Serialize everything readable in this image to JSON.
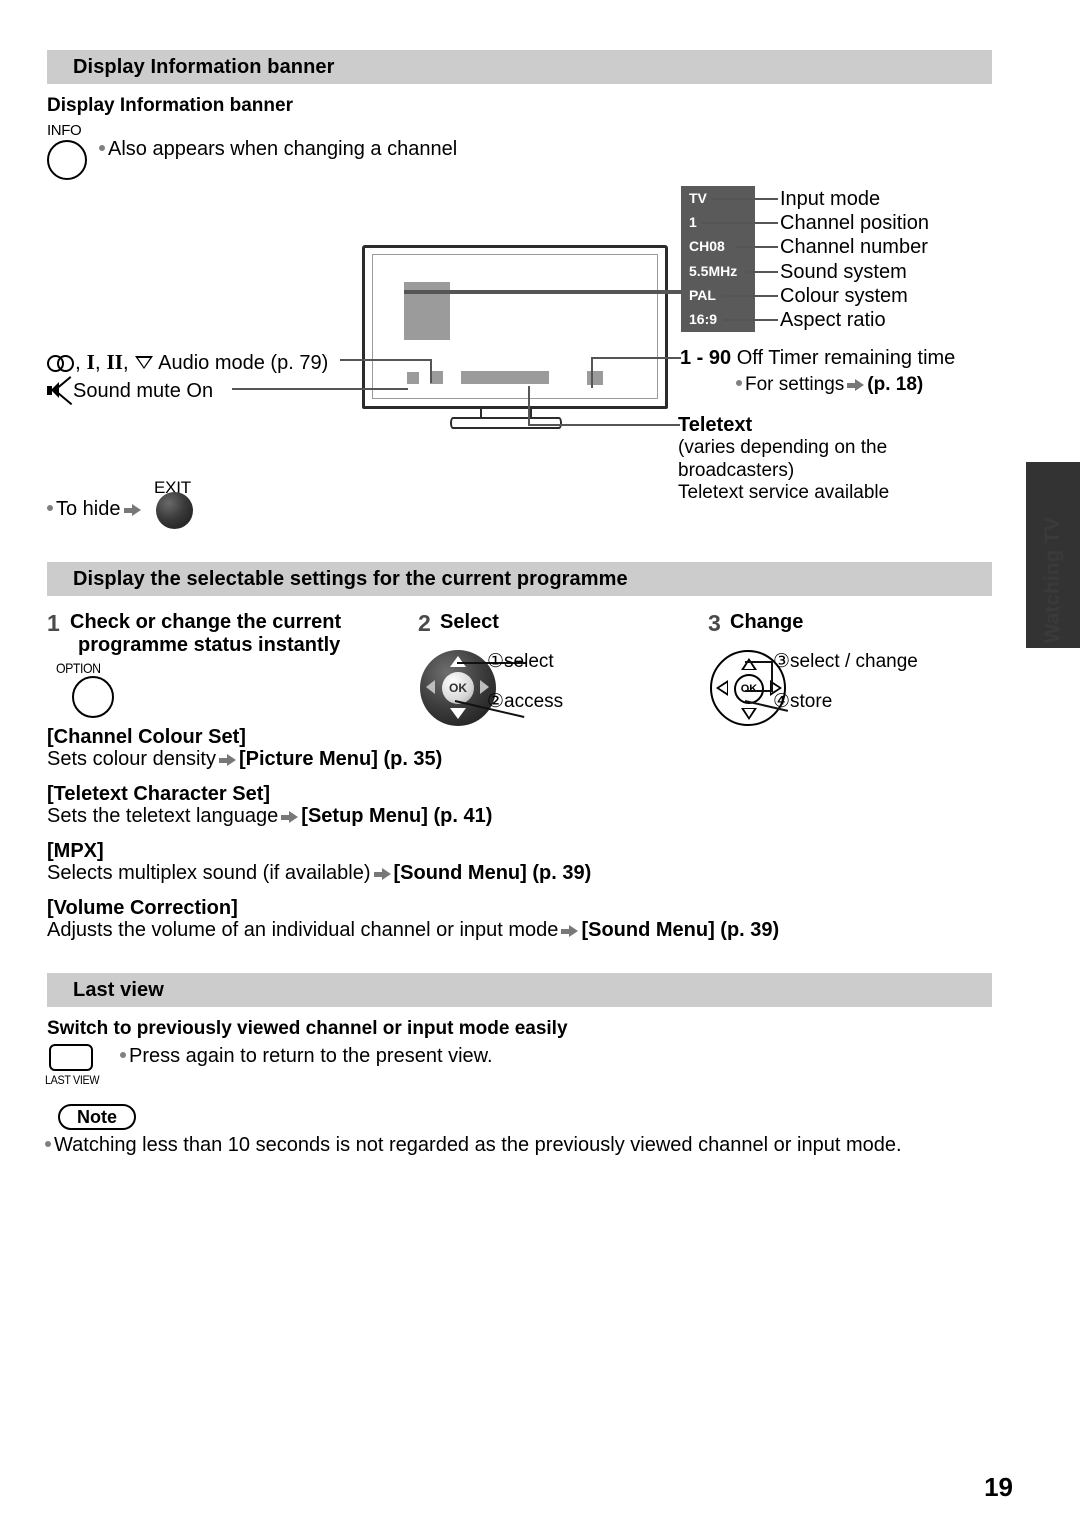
{
  "sections": {
    "display_info": {
      "bar_title": "Display Information banner",
      "subheading": "Display Information banner",
      "info_button_label": "INFO",
      "info_note": "Also appears when changing a channel",
      "audio_mode_label": "Audio mode (p. 79)",
      "sound_mute_label": "Sound mute On",
      "to_hide_label": "To hide",
      "exit_button_label": "EXIT"
    },
    "osd": {
      "rows": [
        {
          "value": "TV",
          "label": "Input mode"
        },
        {
          "value": "1",
          "label": "Channel position"
        },
        {
          "value": "CH08",
          "label": "Channel number"
        },
        {
          "value": "5.5MHz",
          "label": "Sound system"
        },
        {
          "value": "PAL",
          "label": "Colour system"
        },
        {
          "value": "16:9",
          "label": "Aspect ratio"
        }
      ],
      "off_timer_range": "1 - 90",
      "off_timer_label": "Off Timer remaining time",
      "off_timer_note": "For settings",
      "off_timer_ref": "(p. 18)",
      "teletext_heading": "Teletext",
      "teletext_line1": "(varies depending on the",
      "teletext_line2": "broadcasters)",
      "teletext_line3": "Teletext service available"
    },
    "selectable": {
      "bar_title": "Display the selectable settings for the current programme",
      "steps": [
        {
          "num": "1",
          "title_line1": "Check or change the current",
          "title_line2": "programme status instantly",
          "button_label": "OPTION"
        },
        {
          "num": "2",
          "title_line1": "Select",
          "title_line2": "",
          "callout1": "①select",
          "callout2": "②access",
          "ok_label": "OK"
        },
        {
          "num": "3",
          "title_line1": "Change",
          "title_line2": "",
          "callout1": "③select / change",
          "callout2": "④store",
          "ok_label": "OK"
        }
      ],
      "settings": [
        {
          "name": "[Channel Colour Set]",
          "desc_pre": "Sets colour density",
          "desc_post": "[Picture Menu] (p. 35)"
        },
        {
          "name": "[Teletext Character Set]",
          "desc_pre": "Sets the teletext language",
          "desc_post": "[Setup Menu] (p. 41)"
        },
        {
          "name": "[MPX]",
          "desc_pre": "Selects multiplex sound (if available)",
          "desc_post": "[Sound Menu] (p. 39)"
        },
        {
          "name": "[Volume Correction]",
          "desc_pre": "Adjusts the volume of an individual channel or input mode",
          "desc_post": "[Sound Menu] (p. 39)"
        }
      ]
    },
    "last_view": {
      "bar_title": "Last view",
      "subheading": "Switch to previously viewed channel or input mode easily",
      "button_label": "LAST VIEW",
      "note": "Press again to return to the present view."
    },
    "note_block": {
      "pill_label": "Note",
      "text": "Watching less than 10 seconds is not regarded as the previously viewed channel or input mode."
    }
  },
  "side_tab": {
    "label": "Watching TV"
  },
  "page_number": "19",
  "colors": {
    "bar_gray": "#cccccc",
    "osd_box": "#5a5a5a",
    "tv_gray": "#9b9b9b",
    "side_tab": "#333333"
  }
}
